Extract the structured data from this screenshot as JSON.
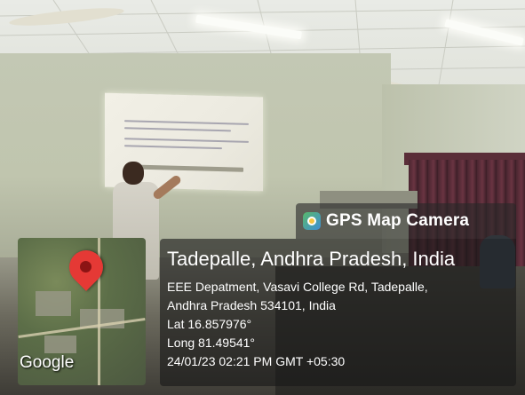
{
  "overlay": {
    "app_name": "GPS Map Camera",
    "icon": "gps-camera-app-icon",
    "location_title": "Tadepalle, Andhra Pradesh, India",
    "address_line_1": "EEE Depatment, Vasavi College Rd, Tadepalle,",
    "address_line_2": "Andhra Pradesh 534101, India",
    "latitude": "Lat 16.857976°",
    "longitude": "Long 81.49541°",
    "timestamp": "24/01/23 02:21 PM GMT +05:30",
    "map_attribution": "Google",
    "pin_color": "#e53935"
  }
}
